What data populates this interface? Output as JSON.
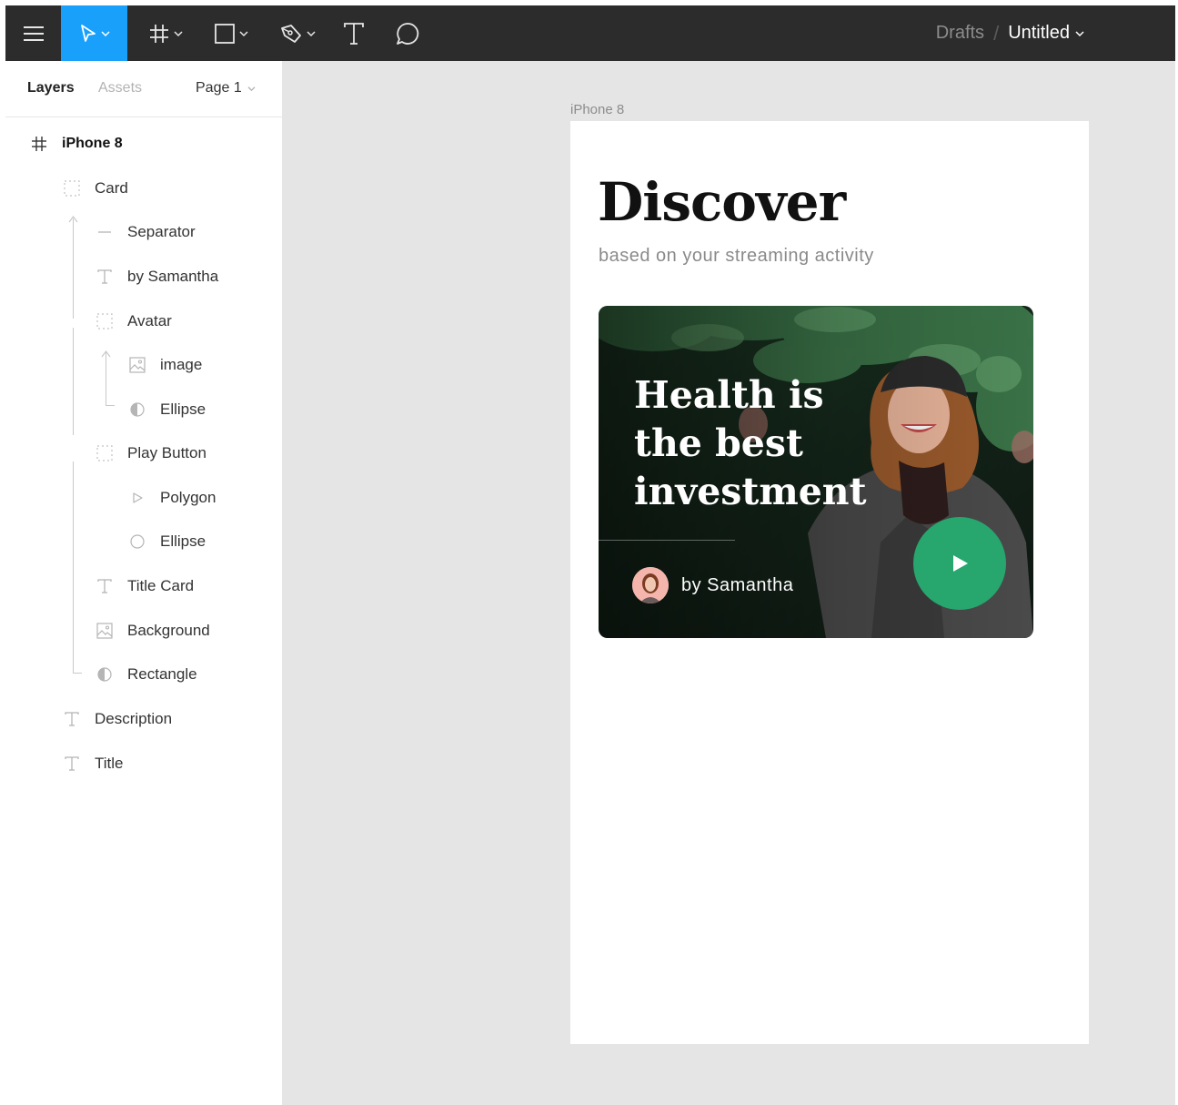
{
  "toolbar": {
    "tools": [
      "menu-icon",
      "move-tool-icon",
      "frame-tool-icon",
      "shape-tool-icon",
      "pen-tool-icon",
      "text-tool-icon",
      "comment-tool-icon"
    ],
    "accent": "#18a0fb",
    "background": "#2c2c2c"
  },
  "breadcrumb": {
    "drafts": "Drafts",
    "separator": "/",
    "file": "Untitled"
  },
  "panel": {
    "tabs": {
      "layers": "Layers",
      "assets": "Assets",
      "page": "Page 1"
    },
    "layers": [
      {
        "label": "iPhone 8",
        "icon": "frame-icon"
      },
      {
        "label": "Card",
        "icon": "group-icon"
      },
      {
        "label": "Separator",
        "icon": "line-icon"
      },
      {
        "label": "by Samantha",
        "icon": "text-icon"
      },
      {
        "label": "Avatar",
        "icon": "group-icon"
      },
      {
        "label": "image",
        "icon": "image-icon"
      },
      {
        "label": "Ellipse",
        "icon": "mask-icon"
      },
      {
        "label": "Play Button",
        "icon": "group-icon"
      },
      {
        "label": "Polygon",
        "icon": "polygon-icon"
      },
      {
        "label": "Ellipse",
        "icon": "ellipse-icon"
      },
      {
        "label": "Title Card",
        "icon": "text-icon"
      },
      {
        "label": "Background",
        "icon": "image-icon"
      },
      {
        "label": "Rectangle",
        "icon": "mask-icon"
      },
      {
        "label": "Description",
        "icon": "text-icon"
      },
      {
        "label": "Title",
        "icon": "text-icon"
      }
    ]
  },
  "canvas": {
    "frame_label": "iPhone 8",
    "title": "Discover",
    "subtitle": "based on your streaming activity",
    "card": {
      "title_lines": [
        "Health is",
        "the best",
        "investment"
      ],
      "author": "by Samantha",
      "play_color": "#27a66e"
    }
  }
}
